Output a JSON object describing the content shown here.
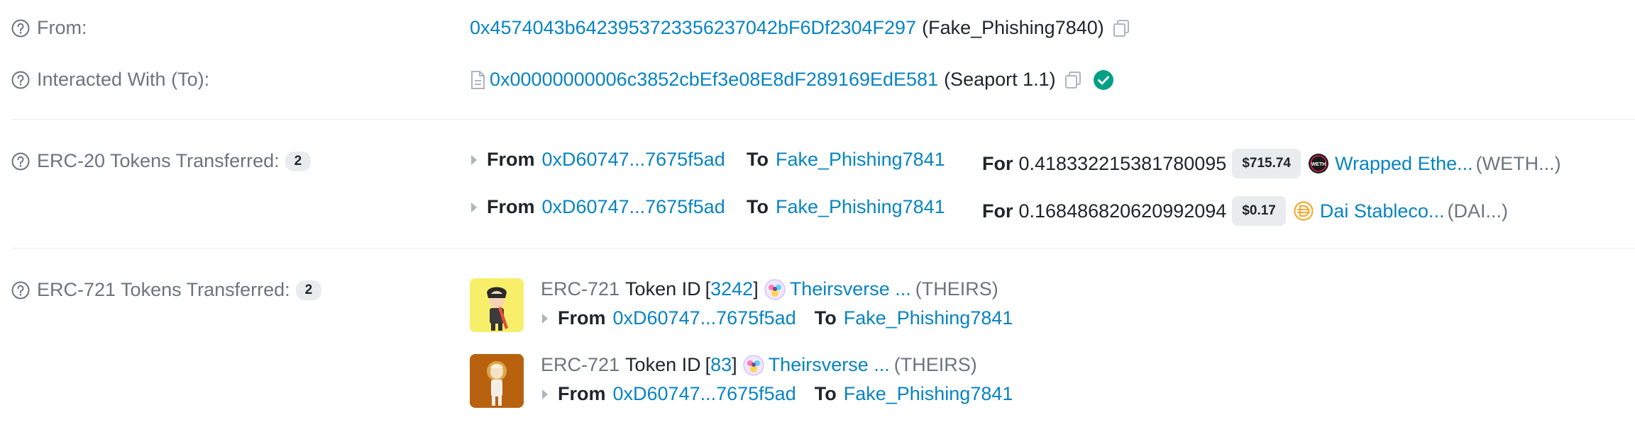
{
  "from": {
    "label": "From:",
    "address": "0x4574043b6423953723356237042bF6Df2304F297",
    "name_tag": "(Fake_Phishing7840)"
  },
  "interacted": {
    "label": "Interacted With (To):",
    "address": "0x00000000006c3852cbEf3e08E8dF289169EdE581",
    "name_tag": "(Seaport 1.1)"
  },
  "erc20": {
    "label": "ERC-20 Tokens Transferred:",
    "count": "2",
    "rows": [
      {
        "from_word": "From",
        "from_addr": "0xD60747...7675f5ad",
        "to_word": "To",
        "to_addr": "Fake_Phishing7841",
        "for_word": "For",
        "amount": "0.418332215381780095",
        "price": "$715.74",
        "token_name": "Wrapped Ethe...",
        "token_symbol": "(WETH...)",
        "token_icon": "weth-icon"
      },
      {
        "from_word": "From",
        "from_addr": "0xD60747...7675f5ad",
        "to_word": "To",
        "to_addr": "Fake_Phishing7841",
        "for_word": "For",
        "amount": "0.168486820620992094",
        "price": "$0.17",
        "token_name": "Dai Stableco...",
        "token_symbol": "(DAI...)",
        "token_icon": "dai-icon"
      }
    ]
  },
  "erc721": {
    "label": "ERC-721 Tokens Transferred:",
    "count": "2",
    "items": [
      {
        "standard": "ERC-721",
        "token_id_word": "Token ID",
        "bracket_open": "[",
        "token_id": "3242",
        "bracket_close": "]",
        "collection": "Theirsverse ...",
        "symbol": "(THEIRS)",
        "from_word": "From",
        "from_addr": "0xD60747...7675f5ad",
        "to_word": "To",
        "to_addr": "Fake_Phishing7841"
      },
      {
        "standard": "ERC-721",
        "token_id_word": "Token ID",
        "bracket_open": "[",
        "token_id": "83",
        "bracket_close": "]",
        "collection": "Theirsverse ...",
        "symbol": "(THEIRS)",
        "from_word": "From",
        "from_addr": "0xD60747...7675f5ad",
        "to_word": "To",
        "to_addr": "Fake_Phishing7841"
      }
    ]
  },
  "colors": {
    "link": "#0784c3",
    "label": "#6c757d",
    "verified": "#00a186",
    "weth_bg": "#1a1a1a",
    "dai": "#f5ac37",
    "nft1_bg": "#f7ef6a",
    "nft2_bg": "#b8620f"
  }
}
